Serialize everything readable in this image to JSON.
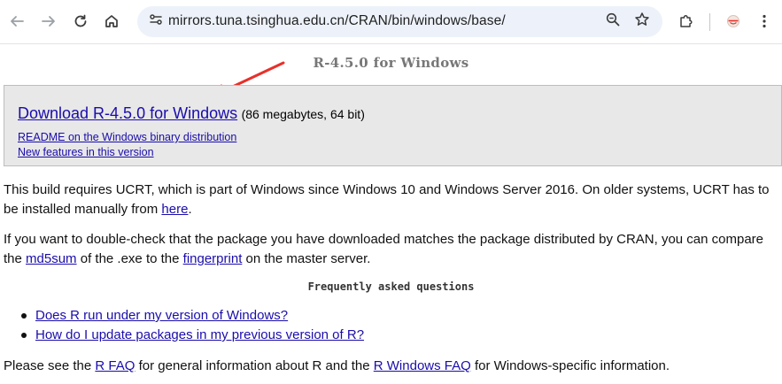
{
  "browser": {
    "url": "mirrors.tuna.tsinghua.edu.cn/CRAN/bin/windows/base/",
    "icons": [
      "back-icon",
      "forward-icon",
      "reload-icon",
      "home-icon",
      "site-info-icon",
      "zoom-icon",
      "bookmark-star-icon",
      "extensions-icon",
      "profile-extension-icon",
      "menu-dots-icon"
    ]
  },
  "page": {
    "title": "R-4.5.0 for Windows",
    "download": {
      "link": "Download R-4.5.0 for Windows",
      "size": "(86 megabytes, 64 bit)",
      "readme": "README on the Windows binary distribution",
      "news": "New features in this version"
    },
    "ucrt": {
      "text_before": "This build requires UCRT, which is part of Windows since Windows 10 and Windows Server 2016. On older systems, UCRT has to be installed manually from ",
      "link": "here",
      "text_after": "."
    },
    "md5": {
      "text1": "If you want to double-check that the package you have downloaded matches the package distributed by CRAN, you can compare the ",
      "link1": "md5sum",
      "text2": " of the .exe to the ",
      "link2": "fingerprint",
      "text3": " on the master server."
    },
    "faq_heading": "Frequently asked questions",
    "faq_items": [
      "Does R run under my version of Windows?",
      "How do I update packages in my previous version of R?"
    ],
    "footer": {
      "text1": "Please see the ",
      "link1": "R FAQ",
      "text2": " for general information about R and the ",
      "link2": "R Windows FAQ",
      "text3": " for Windows-specific information."
    }
  },
  "colors": {
    "link": "#1a0dab",
    "box_background": "#e8e8e8",
    "arrow": "#e8302a",
    "omnibox": "#edf2fa"
  }
}
